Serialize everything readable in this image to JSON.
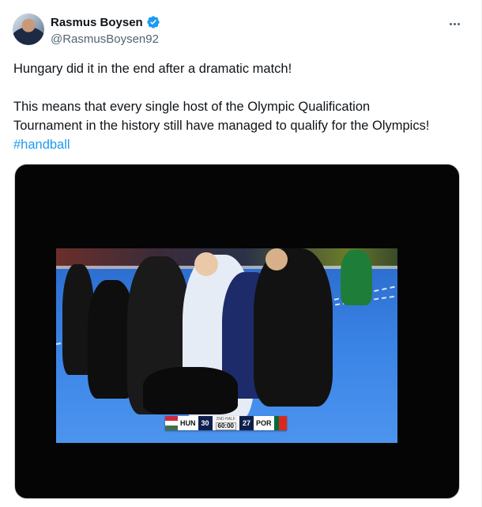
{
  "author": {
    "display_name": "Rasmus Boysen",
    "handle": "@RasmusBoysen92",
    "verified": true,
    "icons": {
      "avatar": "avatar-photo",
      "verified": "verified-badge-icon",
      "more": "more-options-icon"
    }
  },
  "tweet": {
    "paragraph_1": "Hungary did it in the end after a dramatic match!",
    "paragraph_2_line_1": "This means that every single host of the Olympic Qualification",
    "paragraph_2_line_2": "Tournament in the history still have managed to qualify for the Olympics!",
    "hashtag": "#handball"
  },
  "media": {
    "scoreboard": {
      "home_team": "HUN",
      "home_score": "30",
      "period_label": "2ND HALF",
      "clock": "60:00",
      "away_score": "27",
      "away_team": "POR"
    }
  },
  "colors": {
    "text": "#0f1419",
    "secondary": "#536471",
    "link": "#1d9bf0",
    "verified": "#1d9bf0",
    "border": "#cfd9de"
  }
}
